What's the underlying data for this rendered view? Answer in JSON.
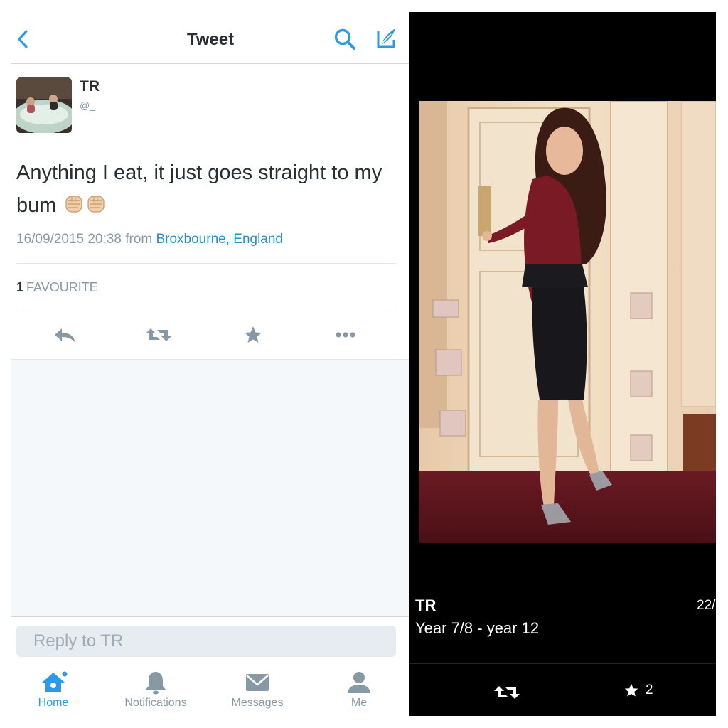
{
  "nav": {
    "title": "Tweet"
  },
  "tweet": {
    "author_name": "TR",
    "author_handle": "@_",
    "text": "Anything I eat, it just goes straight to my bum",
    "timestamp": "16/09/2015 20:38",
    "from_label": "from",
    "location": "Broxbourne, England",
    "favourite_count": "1",
    "favourite_label": "FAVOURITE"
  },
  "reply": {
    "placeholder": "Reply to TR"
  },
  "tabbar": {
    "home": "Home",
    "notifications": "Notifications",
    "messages": "Messages",
    "me": "Me"
  },
  "profile_overlay": {
    "name": "TR",
    "bio": "Year 7/8 - year 12",
    "time": "22/",
    "favourite_count": "2"
  },
  "colors": {
    "link_blue": "#2b8fce",
    "icon_blue": "#2b9ae8",
    "icon_gray": "#8899a6",
    "text_dark": "#292f33"
  },
  "icons": [
    "back-chevron-icon",
    "search-icon",
    "compose-icon",
    "reply-icon",
    "retweet-icon",
    "star-icon",
    "more-icon",
    "home-icon",
    "bell-icon",
    "envelope-icon",
    "person-icon",
    "fist-emoji-icon"
  ]
}
